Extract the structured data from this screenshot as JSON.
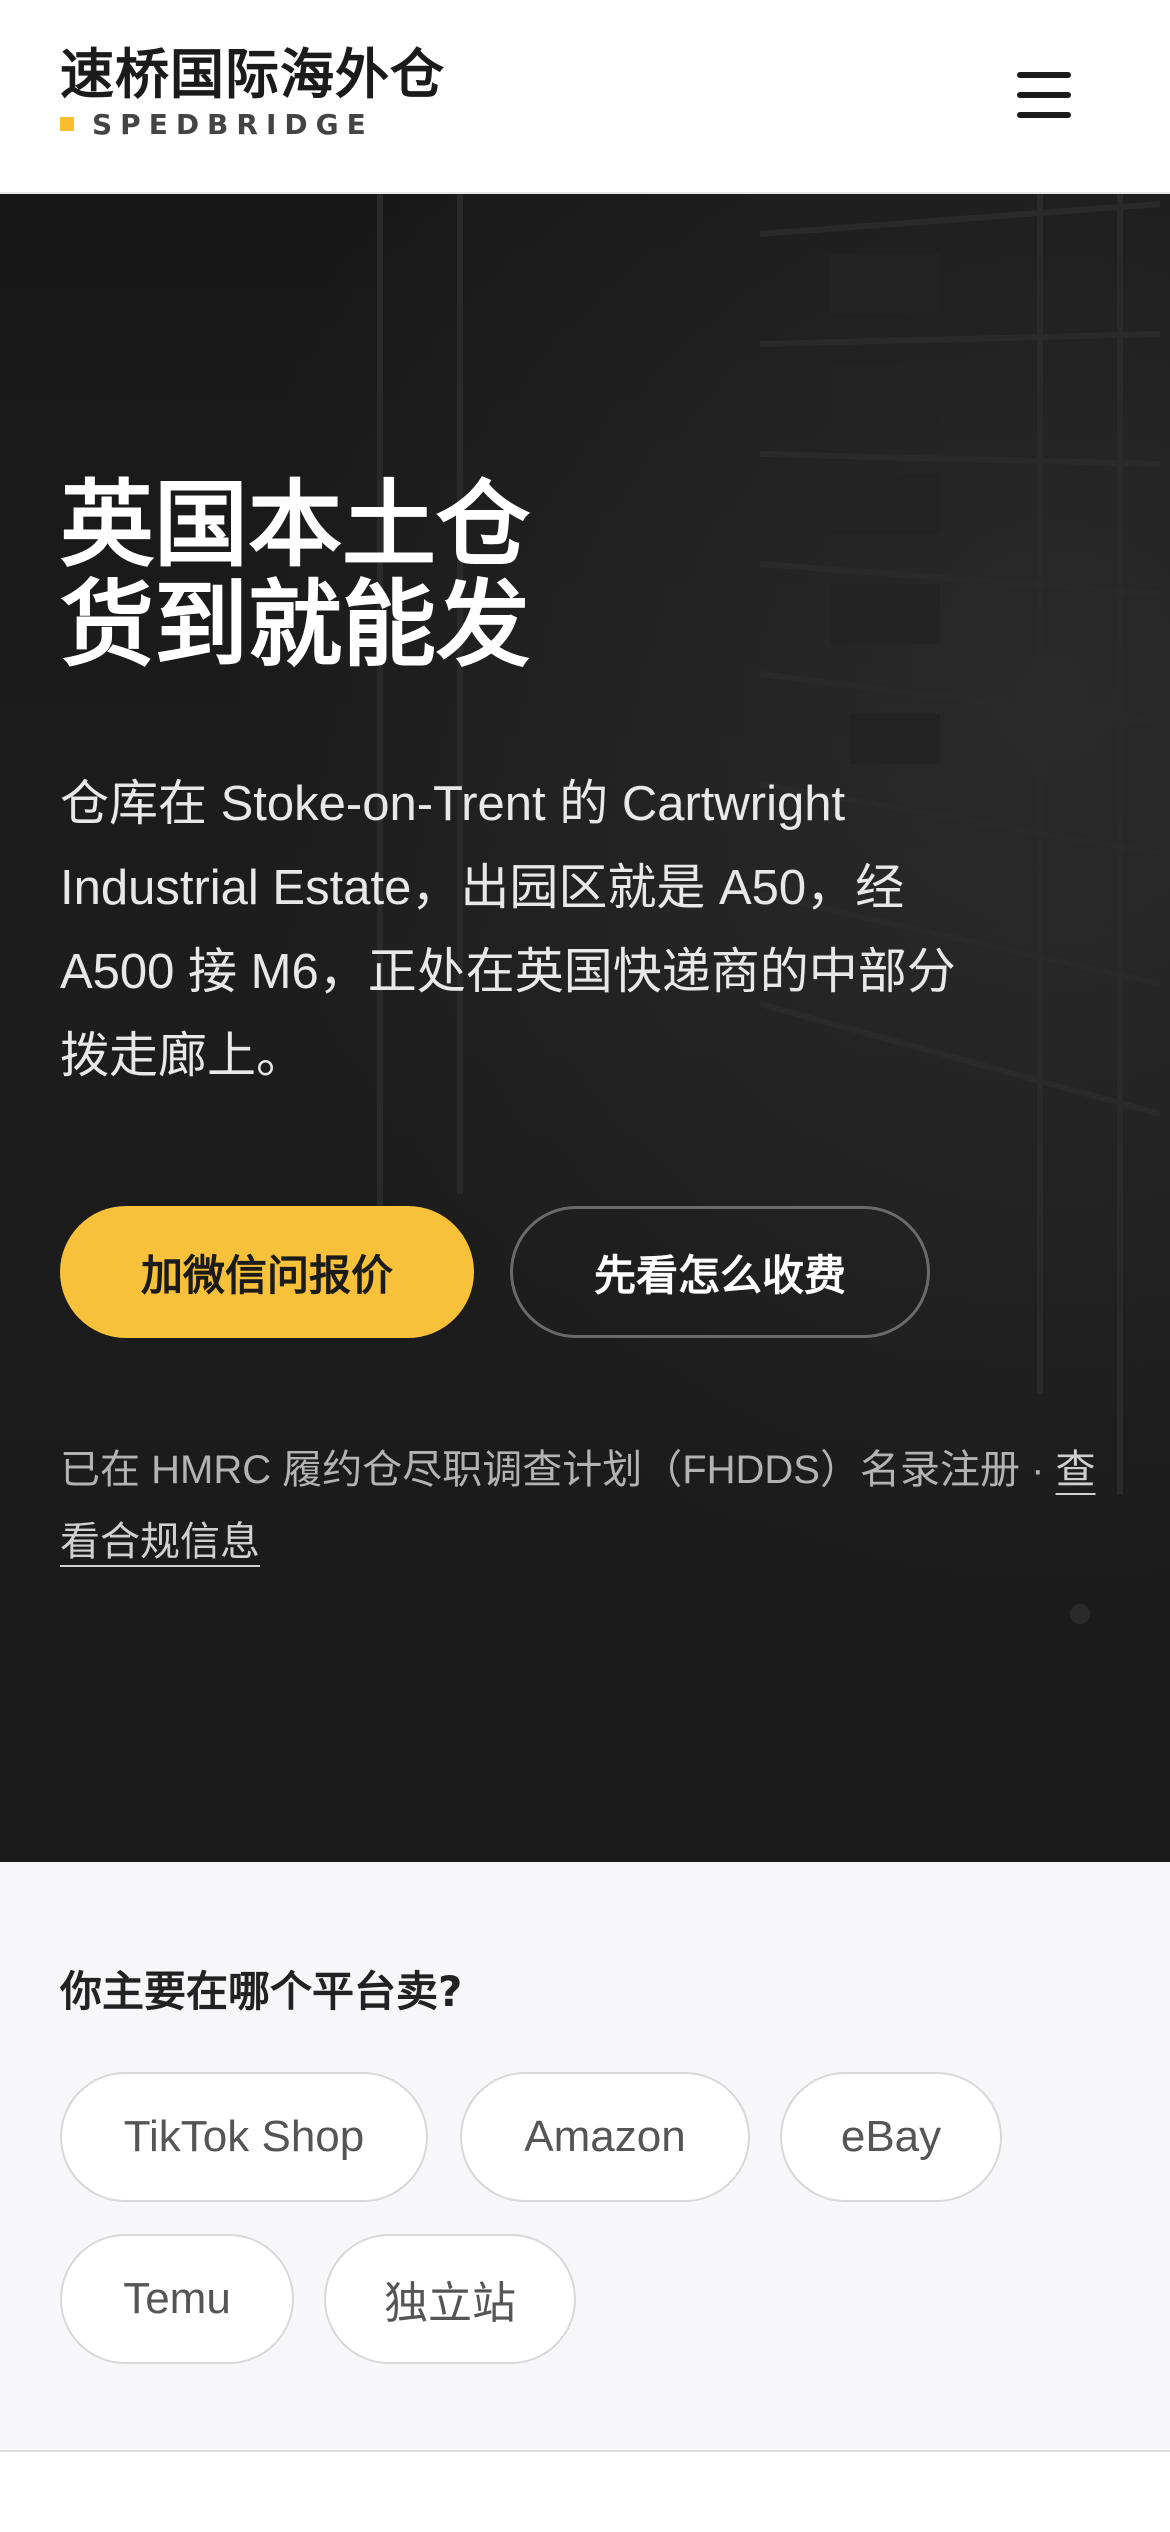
{
  "header": {
    "brand_name": "速桥国际海外仓",
    "brand_en": "SPEDBRIDGE",
    "menu_icon": "hamburger-menu-icon"
  },
  "hero": {
    "title_line1": "英国本土仓",
    "title_line2": "货到就能发",
    "description": "仓库在 Stoke-on-Trent 的 Cartwright Industrial Estate，出园区就是 A50，经 A500 接 M6，正处在英国快递商的中部分拨走廊上。",
    "primary_cta": "加微信问报价",
    "secondary_cta": "先看怎么收费",
    "compliance_note": "已在 HMRC 履约仓尽职调查计划（FHDDS）名录注册 · ",
    "compliance_link": "查看合规信息"
  },
  "platform": {
    "question": "你主要在哪个平台卖?",
    "options": [
      "TikTok Shop",
      "Amazon",
      "eBay",
      "Temu",
      "独立站"
    ]
  },
  "colors": {
    "accent": "#f8c13a",
    "hero_bg": "#1a1a1a",
    "chip_border": "#d8d8d8"
  }
}
